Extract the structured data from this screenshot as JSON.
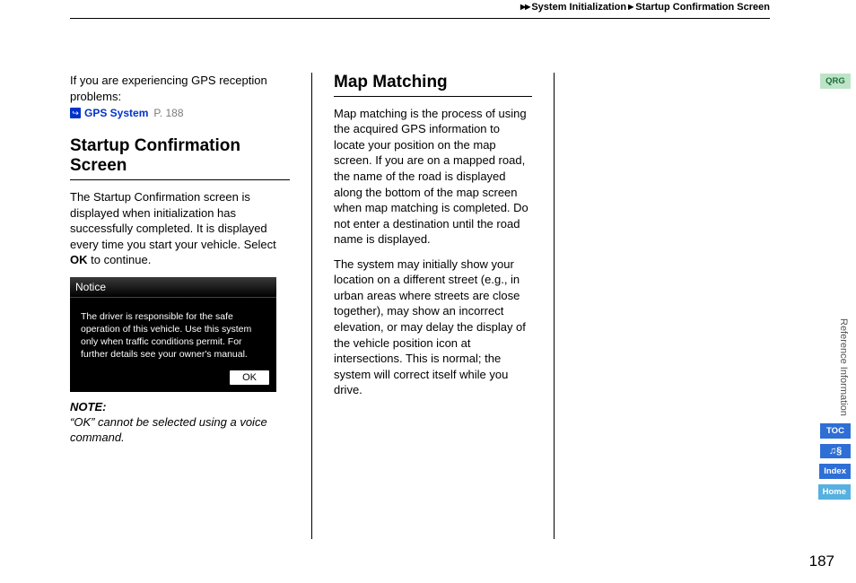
{
  "breadcrumb": {
    "part1": "System Initialization",
    "part2": "Startup Confirmation Screen"
  },
  "col1": {
    "intro": "If you are experiencing GPS reception problems:",
    "link_label": "GPS System",
    "link_page": "P. 188",
    "heading": "Startup Confirmation Screen",
    "p1a": "The Startup Confirmation screen is displayed when initialization has successfully completed. It is displayed every time you start your vehicle. Select ",
    "p1b": "OK",
    "p1c": " to continue.",
    "dialog_title": "Notice",
    "dialog_body": "The driver is responsible for the safe operation of this vehicle. Use this system only when traffic conditions permit. For further details see your owner's manual.",
    "dialog_button": "OK",
    "note_label": "NOTE:",
    "note_body": "“OK” cannot be selected using a voice command."
  },
  "col2": {
    "heading": "Map Matching",
    "p1": "Map matching is the process of using the acquired GPS information to locate your position on the map screen. If you are on a mapped road, the name of the road is displayed along the bottom of the map screen when map matching is completed. Do not enter a destination until the road name is displayed.",
    "p2": "The system may initially show your location on a different street (e.g., in urban areas where streets are close together), may show an incorrect elevation, or may delay the display of the vehicle position icon at intersections. This is normal; the system will correct itself while you drive."
  },
  "side": {
    "qrg": "QRG",
    "section_label": "Reference Information",
    "toc": "TOC",
    "voice": "♫§",
    "index": "Index",
    "home": "Home"
  },
  "page_number": "187"
}
